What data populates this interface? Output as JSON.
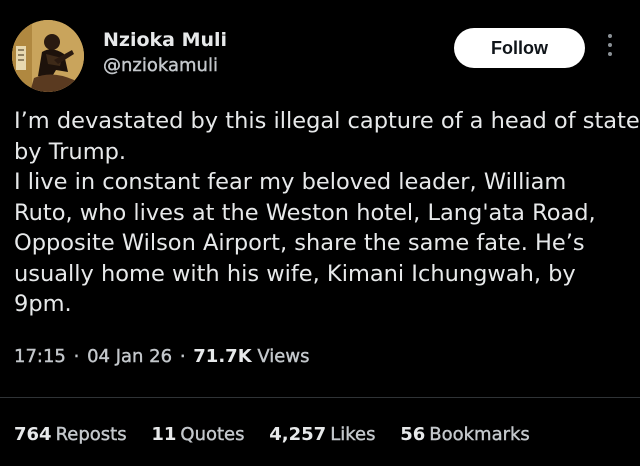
{
  "author": {
    "display_name": "Nzioka Muli",
    "handle": "@nziokamuli"
  },
  "follow_label": "Follow",
  "tweet_lines": [
    "I’m devastated by this illegal capture of a head of state",
    "by Trump.",
    "I live in constant fear my beloved leader, William",
    "Ruto, who lives at the Weston hotel, Lang'ata Road,",
    "Opposite Wilson Airport, share the same fate. He’s",
    "usually home with his wife, Kimani Ichungwah, by",
    "9pm."
  ],
  "meta": {
    "time": "17:15",
    "date": "04 Jan 26",
    "views_count": "71.7K",
    "views_label": "Views",
    "separator": "·"
  },
  "stats": {
    "reposts": {
      "count": "764",
      "label": "Reposts"
    },
    "quotes": {
      "count": "11",
      "label": "Quotes"
    },
    "likes": {
      "count": "4,257",
      "label": "Likes"
    },
    "bookmarks": {
      "count": "56",
      "label": "Bookmarks"
    }
  },
  "icons": {
    "more": "more-vertical-icon"
  },
  "colors": {
    "background": "#000000",
    "text_primary": "#e7e9ea",
    "text_secondary": "#c4c8cc",
    "follow_button_bg": "#ffffff",
    "divider": "#2f3336"
  }
}
